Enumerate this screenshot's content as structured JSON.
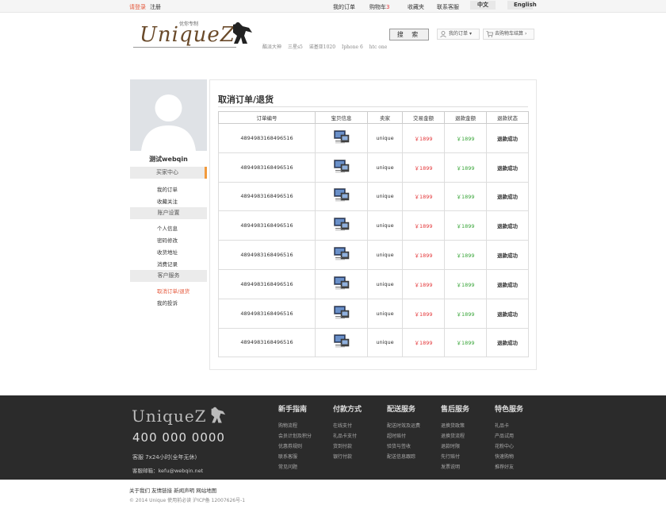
{
  "topbar": {
    "login": "请登录",
    "register": "注册",
    "my_orders": "我的订单",
    "cart": "购物车",
    "cart_count": "3",
    "favorites": "收藏夹",
    "contact": "联系客服",
    "lang_cn": "中文",
    "lang_en": "English"
  },
  "header": {
    "brand": "UniqueZ",
    "tagline": "优你专制",
    "search_label": "搜 索",
    "hotwords": [
      "酷派大神",
      "三星s5",
      "诺基亚1020",
      "Iphone 6",
      "htc one"
    ],
    "my_orders_label": "我的订单",
    "cart_label": "去购物车结算"
  },
  "sidebar": {
    "username": "测试webqin",
    "sections": [
      {
        "title": "买家中心",
        "items": [
          "我的订单",
          "收藏关注"
        ]
      },
      {
        "title": "账户设置",
        "items": [
          "个人信息",
          "密码修改",
          "收货地址",
          "消费记录"
        ]
      },
      {
        "title": "客户服务",
        "items": [
          "取消订单/退货",
          "我的投诉"
        ]
      }
    ]
  },
  "main": {
    "title": "取消订单/退货",
    "columns": [
      "订单编号",
      "宝贝信息",
      "卖家",
      "交易金额",
      "退款金额",
      "退款状态"
    ],
    "rows": [
      {
        "order_no": "4894983168496516",
        "seller": "unique",
        "amount": "￥1899",
        "refund": "￥1899",
        "status": "退款成功"
      },
      {
        "order_no": "4894983168496516",
        "seller": "unique",
        "amount": "￥1899",
        "refund": "￥1899",
        "status": "退款成功"
      },
      {
        "order_no": "4894983168496516",
        "seller": "unique",
        "amount": "￥1899",
        "refund": "￥1899",
        "status": "退款成功"
      },
      {
        "order_no": "4894983168496516",
        "seller": "unique",
        "amount": "￥1899",
        "refund": "￥1899",
        "status": "退款成功"
      },
      {
        "order_no": "4894983168496516",
        "seller": "unique",
        "amount": "￥1899",
        "refund": "￥1899",
        "status": "退款成功"
      },
      {
        "order_no": "4894983168496516",
        "seller": "unique",
        "amount": "￥1899",
        "refund": "￥1899",
        "status": "退款成功"
      },
      {
        "order_no": "4894983168496516",
        "seller": "unique",
        "amount": "￥1899",
        "refund": "￥1899",
        "status": "退款成功"
      },
      {
        "order_no": "4894983168496516",
        "seller": "unique",
        "amount": "￥1899",
        "refund": "￥1899",
        "status": "退款成功"
      }
    ]
  },
  "footer": {
    "brand": "UniqueZ",
    "phone": "400 000 0000",
    "hours": "客服 7x24小时(全年无休)",
    "email": "客服邮箱：kefu@webqin.net",
    "columns": [
      {
        "title": "新手指南",
        "links": [
          "购物流程",
          "会员计划及积分",
          "优惠券规则",
          "联系客服",
          "常见问题"
        ]
      },
      {
        "title": "付款方式",
        "links": [
          "在线支付",
          "礼品卡支付",
          "货到付款",
          "银行付款"
        ]
      },
      {
        "title": "配送服务",
        "links": [
          "配送时效及运费",
          "超时赔付",
          "验货与签收",
          "配送信息跟踪"
        ]
      },
      {
        "title": "售后服务",
        "links": [
          "退换货政策",
          "退换货流程",
          "退款时限",
          "先行赔付",
          "发票说明"
        ]
      },
      {
        "title": "特色服务",
        "links": [
          "礼品卡",
          "产品试用",
          "花粉中心",
          "快速购物",
          "推荐好友"
        ]
      }
    ],
    "bottom_links": "关于我们 友情链接 新闻声明 网站地图",
    "copyright": "© 2014 Unique 使用前必读 沪ICP备 12007626号-1"
  },
  "colors": {
    "accent": "#e4573a",
    "price_red": "#e4393c",
    "price_green": "#3aa63a",
    "footer_bg": "#2b2b2b",
    "active_marker": "#f29a3c"
  }
}
